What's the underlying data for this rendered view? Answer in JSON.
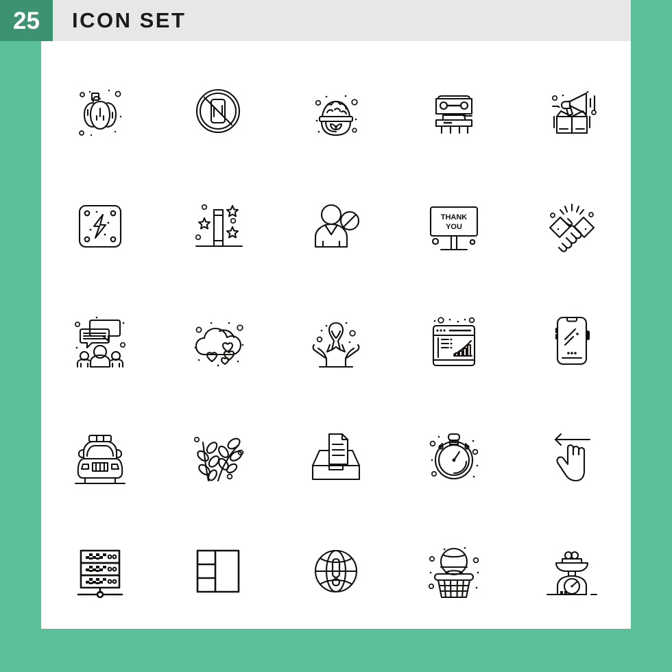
{
  "header": {
    "count": "25",
    "title": "ICON SET",
    "badge_color": "#3d9272",
    "bar_color": "#e7e7e7",
    "background_color": "#5bbf98",
    "panel_color": "#ffffff"
  },
  "grid": {
    "columns": 5,
    "rows": 5,
    "stroke_color": "#120f0d"
  },
  "icons": [
    {
      "row": 1,
      "col": 1,
      "name": "pumpkin-icon",
      "label": "Pumpkin"
    },
    {
      "row": 1,
      "col": 2,
      "name": "no-mobile-phone-icon",
      "label": "No Mobile Phone"
    },
    {
      "row": 1,
      "col": 3,
      "name": "rice-bowl-icon",
      "label": "Rice Bowl"
    },
    {
      "row": 1,
      "col": 4,
      "name": "grandstand-icon",
      "label": "Grandstand"
    },
    {
      "row": 1,
      "col": 5,
      "name": "product-launch-icon",
      "label": "Product Launch"
    },
    {
      "row": 2,
      "col": 1,
      "name": "electric-power-icon",
      "label": "Electric Power"
    },
    {
      "row": 2,
      "col": 2,
      "name": "firework-fountain-icon",
      "label": "Firework Fountain"
    },
    {
      "row": 2,
      "col": 3,
      "name": "blocked-user-icon",
      "label": "Blocked User"
    },
    {
      "row": 2,
      "col": 4,
      "name": "thank-you-billboard-icon",
      "label": "Thank You Billboard"
    },
    {
      "row": 2,
      "col": 5,
      "name": "handshake-icon",
      "label": "Handshake"
    },
    {
      "row": 3,
      "col": 1,
      "name": "group-discussion-icon",
      "label": "Group Discussion"
    },
    {
      "row": 3,
      "col": 2,
      "name": "love-cloud-icon",
      "label": "Love Cloud"
    },
    {
      "row": 3,
      "col": 3,
      "name": "awareness-ribbon-icon",
      "label": "Awareness Ribbon"
    },
    {
      "row": 3,
      "col": 4,
      "name": "analytics-browser-icon",
      "label": "Analytics Browser"
    },
    {
      "row": 3,
      "col": 5,
      "name": "smartphone-icon",
      "label": "Smartphone"
    },
    {
      "row": 4,
      "col": 1,
      "name": "police-car-icon",
      "label": "Police Car"
    },
    {
      "row": 4,
      "col": 2,
      "name": "branches-icon",
      "label": "Branches"
    },
    {
      "row": 4,
      "col": 3,
      "name": "document-tray-icon",
      "label": "Document Tray"
    },
    {
      "row": 4,
      "col": 4,
      "name": "stopwatch-icon",
      "label": "Stopwatch"
    },
    {
      "row": 4,
      "col": 5,
      "name": "swipe-left-icon",
      "label": "Swipe Left"
    },
    {
      "row": 5,
      "col": 1,
      "name": "server-rack-icon",
      "label": "Server Rack"
    },
    {
      "row": 5,
      "col": 2,
      "name": "layout-grid-icon",
      "label": "Layout Grid"
    },
    {
      "row": 5,
      "col": 3,
      "name": "global-alert-icon",
      "label": "Global Alert"
    },
    {
      "row": 5,
      "col": 4,
      "name": "basketball-hoop-icon",
      "label": "Basketball Hoop"
    },
    {
      "row": 5,
      "col": 5,
      "name": "kitchen-scale-icon",
      "label": "Kitchen Scale"
    }
  ],
  "icon_text": {
    "billboard_line1": "THANK",
    "billboard_line2": "YOU"
  }
}
